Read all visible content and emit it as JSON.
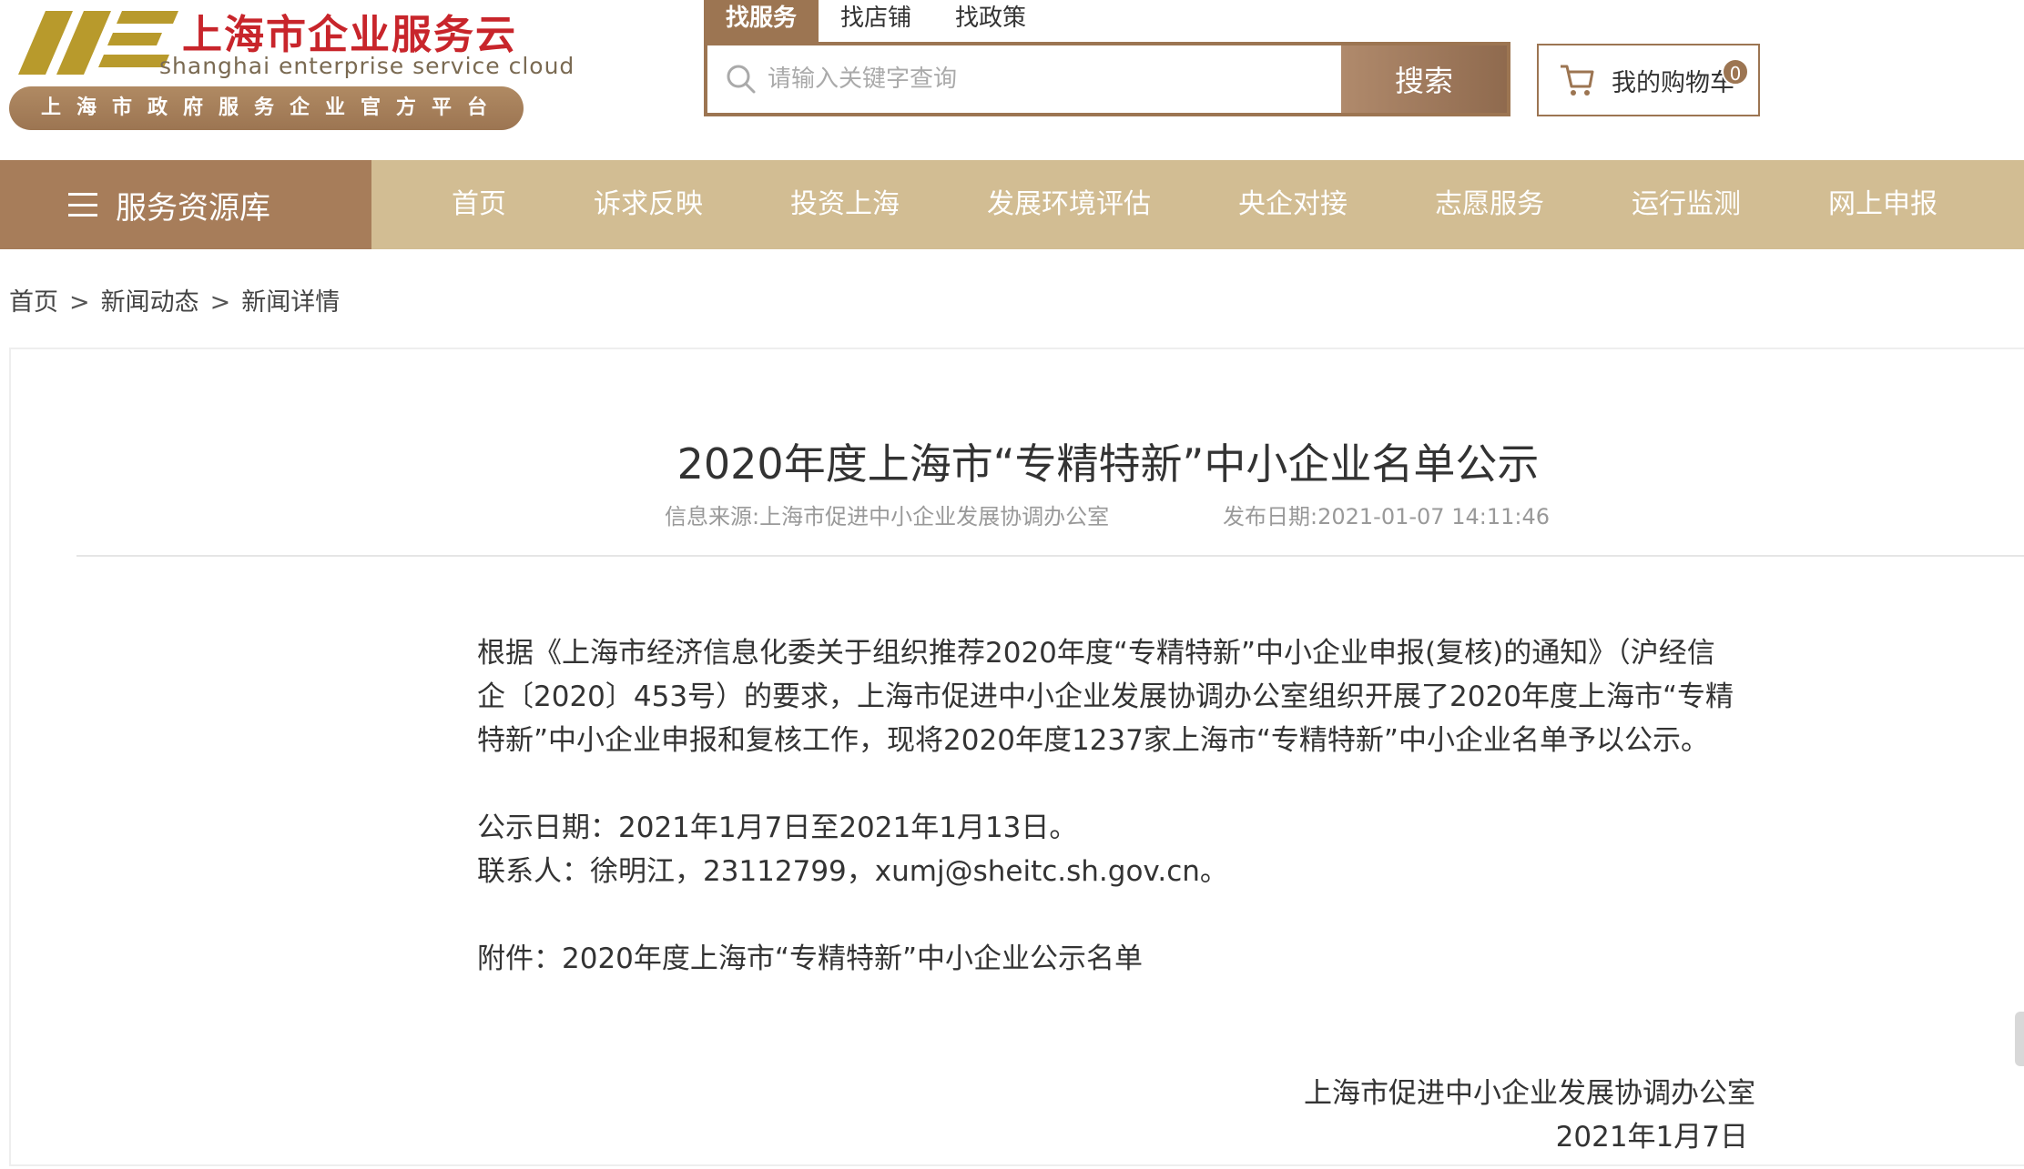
{
  "logo": {
    "title": "上海市企业服务云",
    "subtitle": "shanghai enterprise service cloud",
    "platform": "上海市政府服务企业官方平台",
    "brand_gold": "#b89a2c",
    "brand_red": "#c8252b"
  },
  "search": {
    "tabs": [
      {
        "label": "找服务",
        "active": true
      },
      {
        "label": "找店铺",
        "active": false
      },
      {
        "label": "找政策",
        "active": false
      }
    ],
    "placeholder": "请输入关键字查询",
    "button_label": "搜索",
    "icon": "search-icon"
  },
  "cart": {
    "label": "我的购物车",
    "count": "0",
    "icon": "cart-icon"
  },
  "nav": {
    "resource_label": "服务资源库",
    "items": [
      {
        "label": "首页"
      },
      {
        "label": "诉求反映"
      },
      {
        "label": "投资上海"
      },
      {
        "label": "发展环境评估"
      },
      {
        "label": "央企对接"
      },
      {
        "label": "志愿服务"
      },
      {
        "label": "运行监测"
      },
      {
        "label": "网上申报"
      }
    ]
  },
  "breadcrumb": {
    "items": [
      "首页",
      "新闻动态",
      "新闻详情"
    ],
    "separator": ">"
  },
  "article": {
    "title": "2020年度上海市“专精特新”中小企业名单公示",
    "source": "信息来源:上海市促进中小企业发展协调办公室",
    "date": "发布日期:2021-01-07 14:11:46",
    "paragraphs": [
      "根据《上海市经济信息化委关于组织推荐2020年度“专精特新”中小企业申报(复核)的通知》（沪经信企〔2020〕453号）的要求，上海市促进中小企业发展协调办公室组织开展了2020年度上海市“专精特新”中小企业申报和复核工作，现将2020年度1237家上海市“专精特新”中小企业名单予以公示。",
      "公示日期：2021年1月7日至2021年1月13日。",
      "联系人：徐明江，23112799，xumj@sheitc.sh.gov.cn。",
      "附件：2020年度上海市“专精特新”中小企业公示名单"
    ],
    "signature_org": "上海市促进中小企业发展协调办公室",
    "signature_date": "2021年1月7日"
  },
  "colors": {
    "accent_brown": "#9c7552",
    "nav_bg": "#d2bd93",
    "resource_bg": "#a77d5a"
  }
}
